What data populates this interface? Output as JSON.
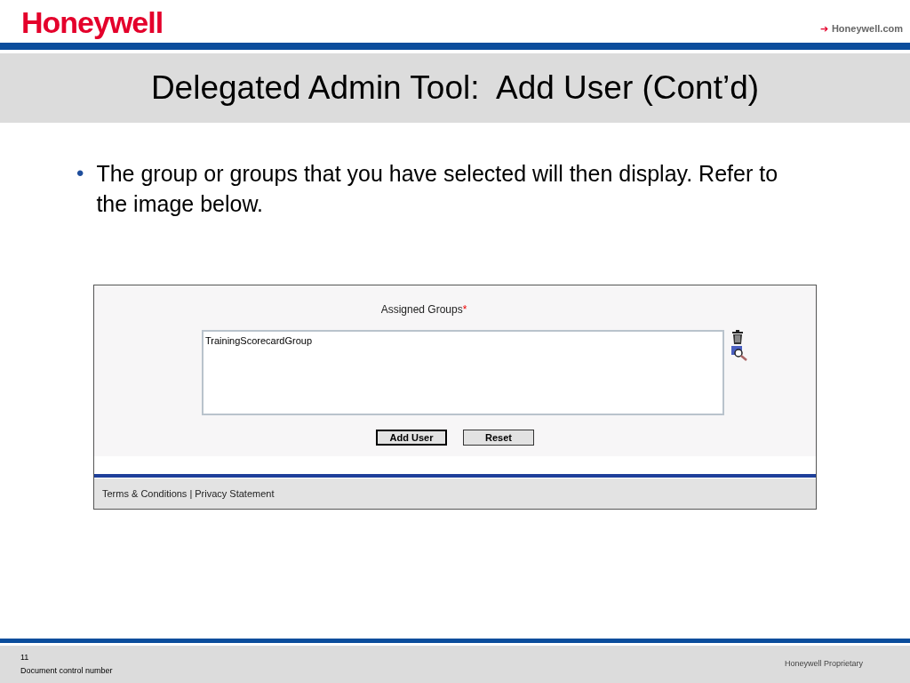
{
  "header": {
    "logo": "Honeywell",
    "link_arrow": "➔",
    "link": "Honeywell.com"
  },
  "title": "Delegated Admin Tool:  Add User (Cont’d)",
  "bullet_mark": "•",
  "bullets": [
    "The group or groups that you have selected will then display. Refer to the image below."
  ],
  "screenshot": {
    "field_label": "Assigned Groups",
    "required_mark": "*",
    "groups": [
      "TrainingScorecardGroup"
    ],
    "buttons": [
      {
        "label": "Add User",
        "default": true
      },
      {
        "label": "Reset",
        "default": false
      }
    ],
    "footer_links": [
      "Terms & Conditions",
      "Privacy Statement"
    ],
    "footer_separator": "|"
  },
  "footer": {
    "page_number": "11",
    "doc_control": "Document control number",
    "proprietary": "Honeywell Proprietary"
  }
}
